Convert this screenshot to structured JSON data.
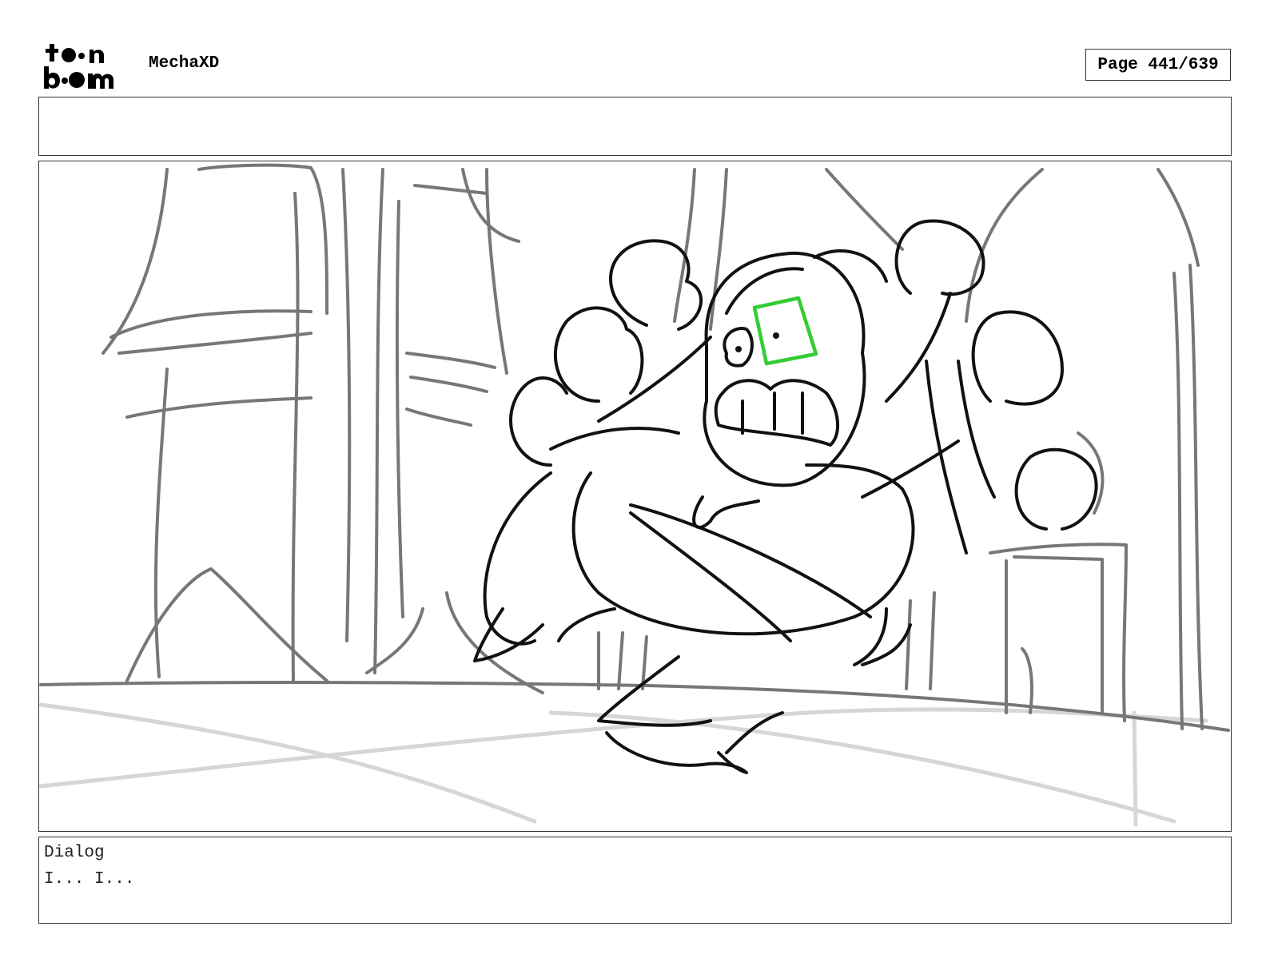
{
  "header": {
    "logo_text_line1": "toon",
    "logo_text_line2": "boom",
    "project_title": "MechaXD",
    "page_indicator": "Page 441/639"
  },
  "notes": {
    "text": ""
  },
  "panel": {
    "sketch_stroke_color": "#111111",
    "background_stroke_color": "#777777",
    "floor_stroke_color": "#d6d6d6",
    "highlight_color": "#33cc33"
  },
  "dialog": {
    "label": "Dialog",
    "text": "I... I..."
  }
}
